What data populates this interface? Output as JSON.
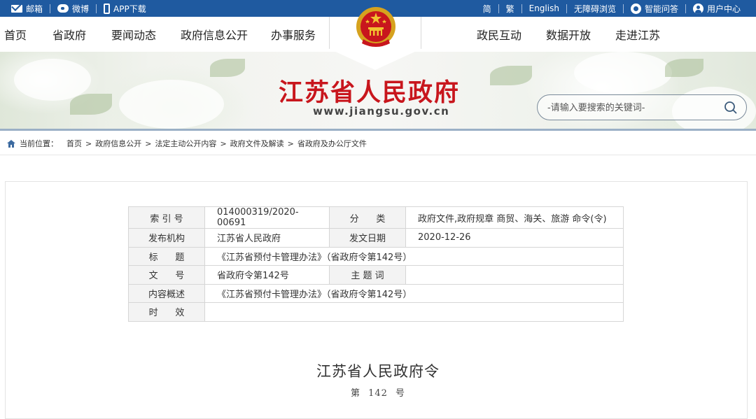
{
  "topbar": {
    "left": [
      {
        "label": "邮箱",
        "icon": "mail-icon"
      },
      {
        "label": "微博",
        "icon": "weibo-icon"
      },
      {
        "label": "APP下载",
        "icon": "phone-icon"
      }
    ],
    "right": {
      "simplified": "简",
      "traditional": "繁",
      "english": "English",
      "accessibility": "无障碍浏览",
      "qa": "智能问答",
      "user_center": "用户中心"
    }
  },
  "nav": {
    "left": [
      "首页",
      "省政府",
      "要闻动态",
      "政府信息公开",
      "办事服务"
    ],
    "right": [
      "政民互动",
      "数据开放",
      "走进江苏"
    ]
  },
  "banner": {
    "title": "江苏省人民政府",
    "domain": "www.jiangsu.gov.cn",
    "search_placeholder": "-请输入要搜索的关键词-"
  },
  "breadcrumb": {
    "label": "当前位置：",
    "items": [
      "首页",
      "政府信息公开",
      "法定主动公开内容",
      "政府文件及解读",
      "省政府及办公厅文件"
    ],
    "separator": ">"
  },
  "meta": {
    "index_label": "索 引 号",
    "index_value": "014000319/2020-00691",
    "category_label": "分      类",
    "category_value": "政府文件,政府规章 商贸、海关、旅游 命令(令)",
    "publisher_label": "发布机构",
    "publisher_value": "江苏省人民政府",
    "date_label": "发文日期",
    "date_value": "2020-12-26",
    "title_label": "标      题",
    "title_value": "《江苏省预付卡管理办法》（省政府令第142号）",
    "docno_label": "文      号",
    "docno_value": "省政府令第142号",
    "keywords_label": "主 题 词",
    "keywords_value": "",
    "summary_label": "内容概述",
    "summary_value": "《江苏省预付卡管理办法》（省政府令第142号）",
    "validity_label": "时      效",
    "validity_value": ""
  },
  "document": {
    "title": "江苏省人民政府令",
    "number": "第 142 号"
  },
  "colors": {
    "topbar": "#1f5aa0",
    "title_red": "#c8161d"
  }
}
